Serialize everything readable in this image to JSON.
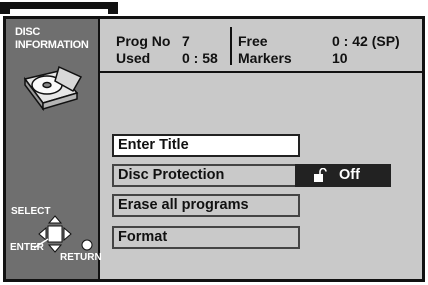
{
  "sidebar": {
    "title_line1": "DISC",
    "title_line2": "INFORMATION",
    "nav": {
      "select": "SELECT",
      "enter": "ENTER",
      "return": "RETURN"
    }
  },
  "info": {
    "prog_label": "Prog No",
    "prog_value": "7",
    "used_label": "Used",
    "used_value": "0 : 58",
    "free_label": "Free",
    "free_value": "0 : 42 (SP)",
    "markers_label": "Markers",
    "markers_value": "10"
  },
  "menu": {
    "items": [
      {
        "label": "Enter Title"
      },
      {
        "label": "Disc Protection"
      },
      {
        "label": "Erase all programs"
      },
      {
        "label": "Format"
      }
    ],
    "disc_protection_value": "Off"
  }
}
